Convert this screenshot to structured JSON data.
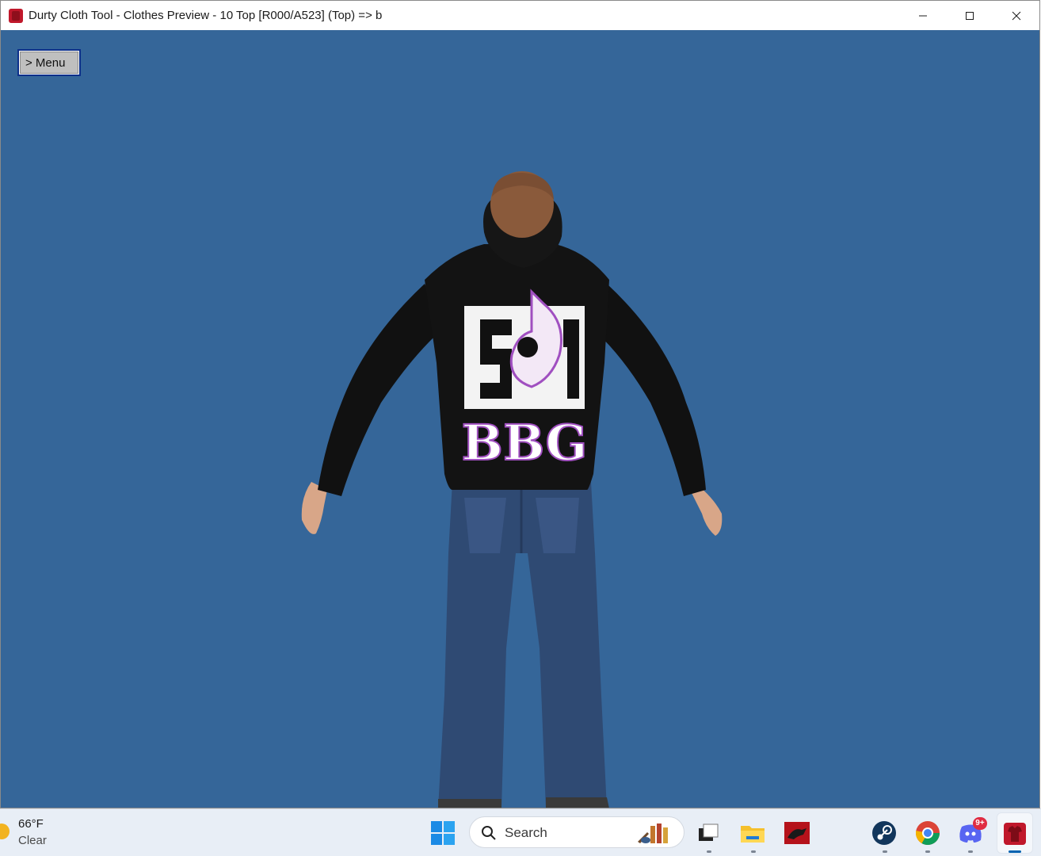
{
  "window": {
    "title": "Durty Cloth Tool - Clothes Preview - 10 Top [R000/A523] (Top) => b",
    "controls": {
      "minimize": "—",
      "maximize": "☐",
      "close": "✕"
    }
  },
  "viewport": {
    "menu_button_label": "> Menu",
    "background_color": "#356699",
    "hoodie_print_text": "BBG"
  },
  "taskbar": {
    "weather": {
      "temperature": "66°F",
      "condition": "Clear"
    },
    "search": {
      "label": "Search"
    },
    "discord_badge": "9+",
    "pinned_apps": [
      "file-explorer-icon",
      "folder-icon",
      "red-app-icon",
      "steam-icon",
      "chrome-icon",
      "discord-icon",
      "durty-cloth-tool-icon"
    ]
  }
}
